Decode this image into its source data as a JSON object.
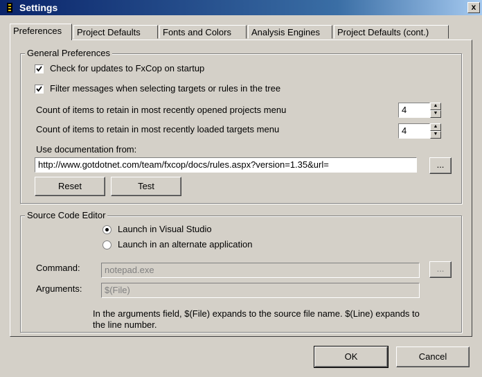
{
  "window": {
    "title": "Settings",
    "close_glyph": "x"
  },
  "tabs": [
    {
      "label": "Preferences",
      "active": true
    },
    {
      "label": "Project Defaults",
      "active": false
    },
    {
      "label": "Fonts and Colors",
      "active": false
    },
    {
      "label": "Analysis Engines",
      "active": false
    },
    {
      "label": "Project Defaults (cont.)",
      "active": false
    }
  ],
  "general": {
    "legend": "General Preferences",
    "check_updates": {
      "label": "Check for updates to FxCop on startup",
      "checked": true
    },
    "filter_messages": {
      "label": "Filter messages when selecting targets or rules in the tree",
      "checked": true
    },
    "recent_projects": {
      "label": "Count of items to retain in most recently opened projects menu",
      "value": "4"
    },
    "recent_targets": {
      "label": "Count of items to retain in most recently loaded targets menu",
      "value": "4"
    },
    "doc_label": "Use documentation from:",
    "doc_url": "http://www.gotdotnet.com/team/fxcop/docs/rules.aspx?version=1.35&url=",
    "browse_label": "...",
    "reset_label": "Reset",
    "test_label": "Test"
  },
  "source": {
    "legend": "Source Code Editor",
    "launch_vs": {
      "label": "Launch in Visual Studio",
      "selected": true
    },
    "launch_alt": {
      "label": "Launch in an alternate application",
      "selected": false
    },
    "command_label": "Command:",
    "command_value": "notepad.exe",
    "command_browse": "...",
    "arguments_label": "Arguments:",
    "arguments_value": "$(File)",
    "help_text_line1": "In the arguments field, $(File) expands to the source file name. $(Line) expands to",
    "help_text_line2": "the line number."
  },
  "footer": {
    "ok_label": "OK",
    "cancel_label": "Cancel"
  },
  "colors": {
    "face": "#d4d0c8",
    "title_start": "#0a246a",
    "title_end": "#a6caf0"
  },
  "icons": [
    "app-icon",
    "close-icon",
    "checkmark-icon",
    "spin-up-icon",
    "spin-down-icon"
  ]
}
